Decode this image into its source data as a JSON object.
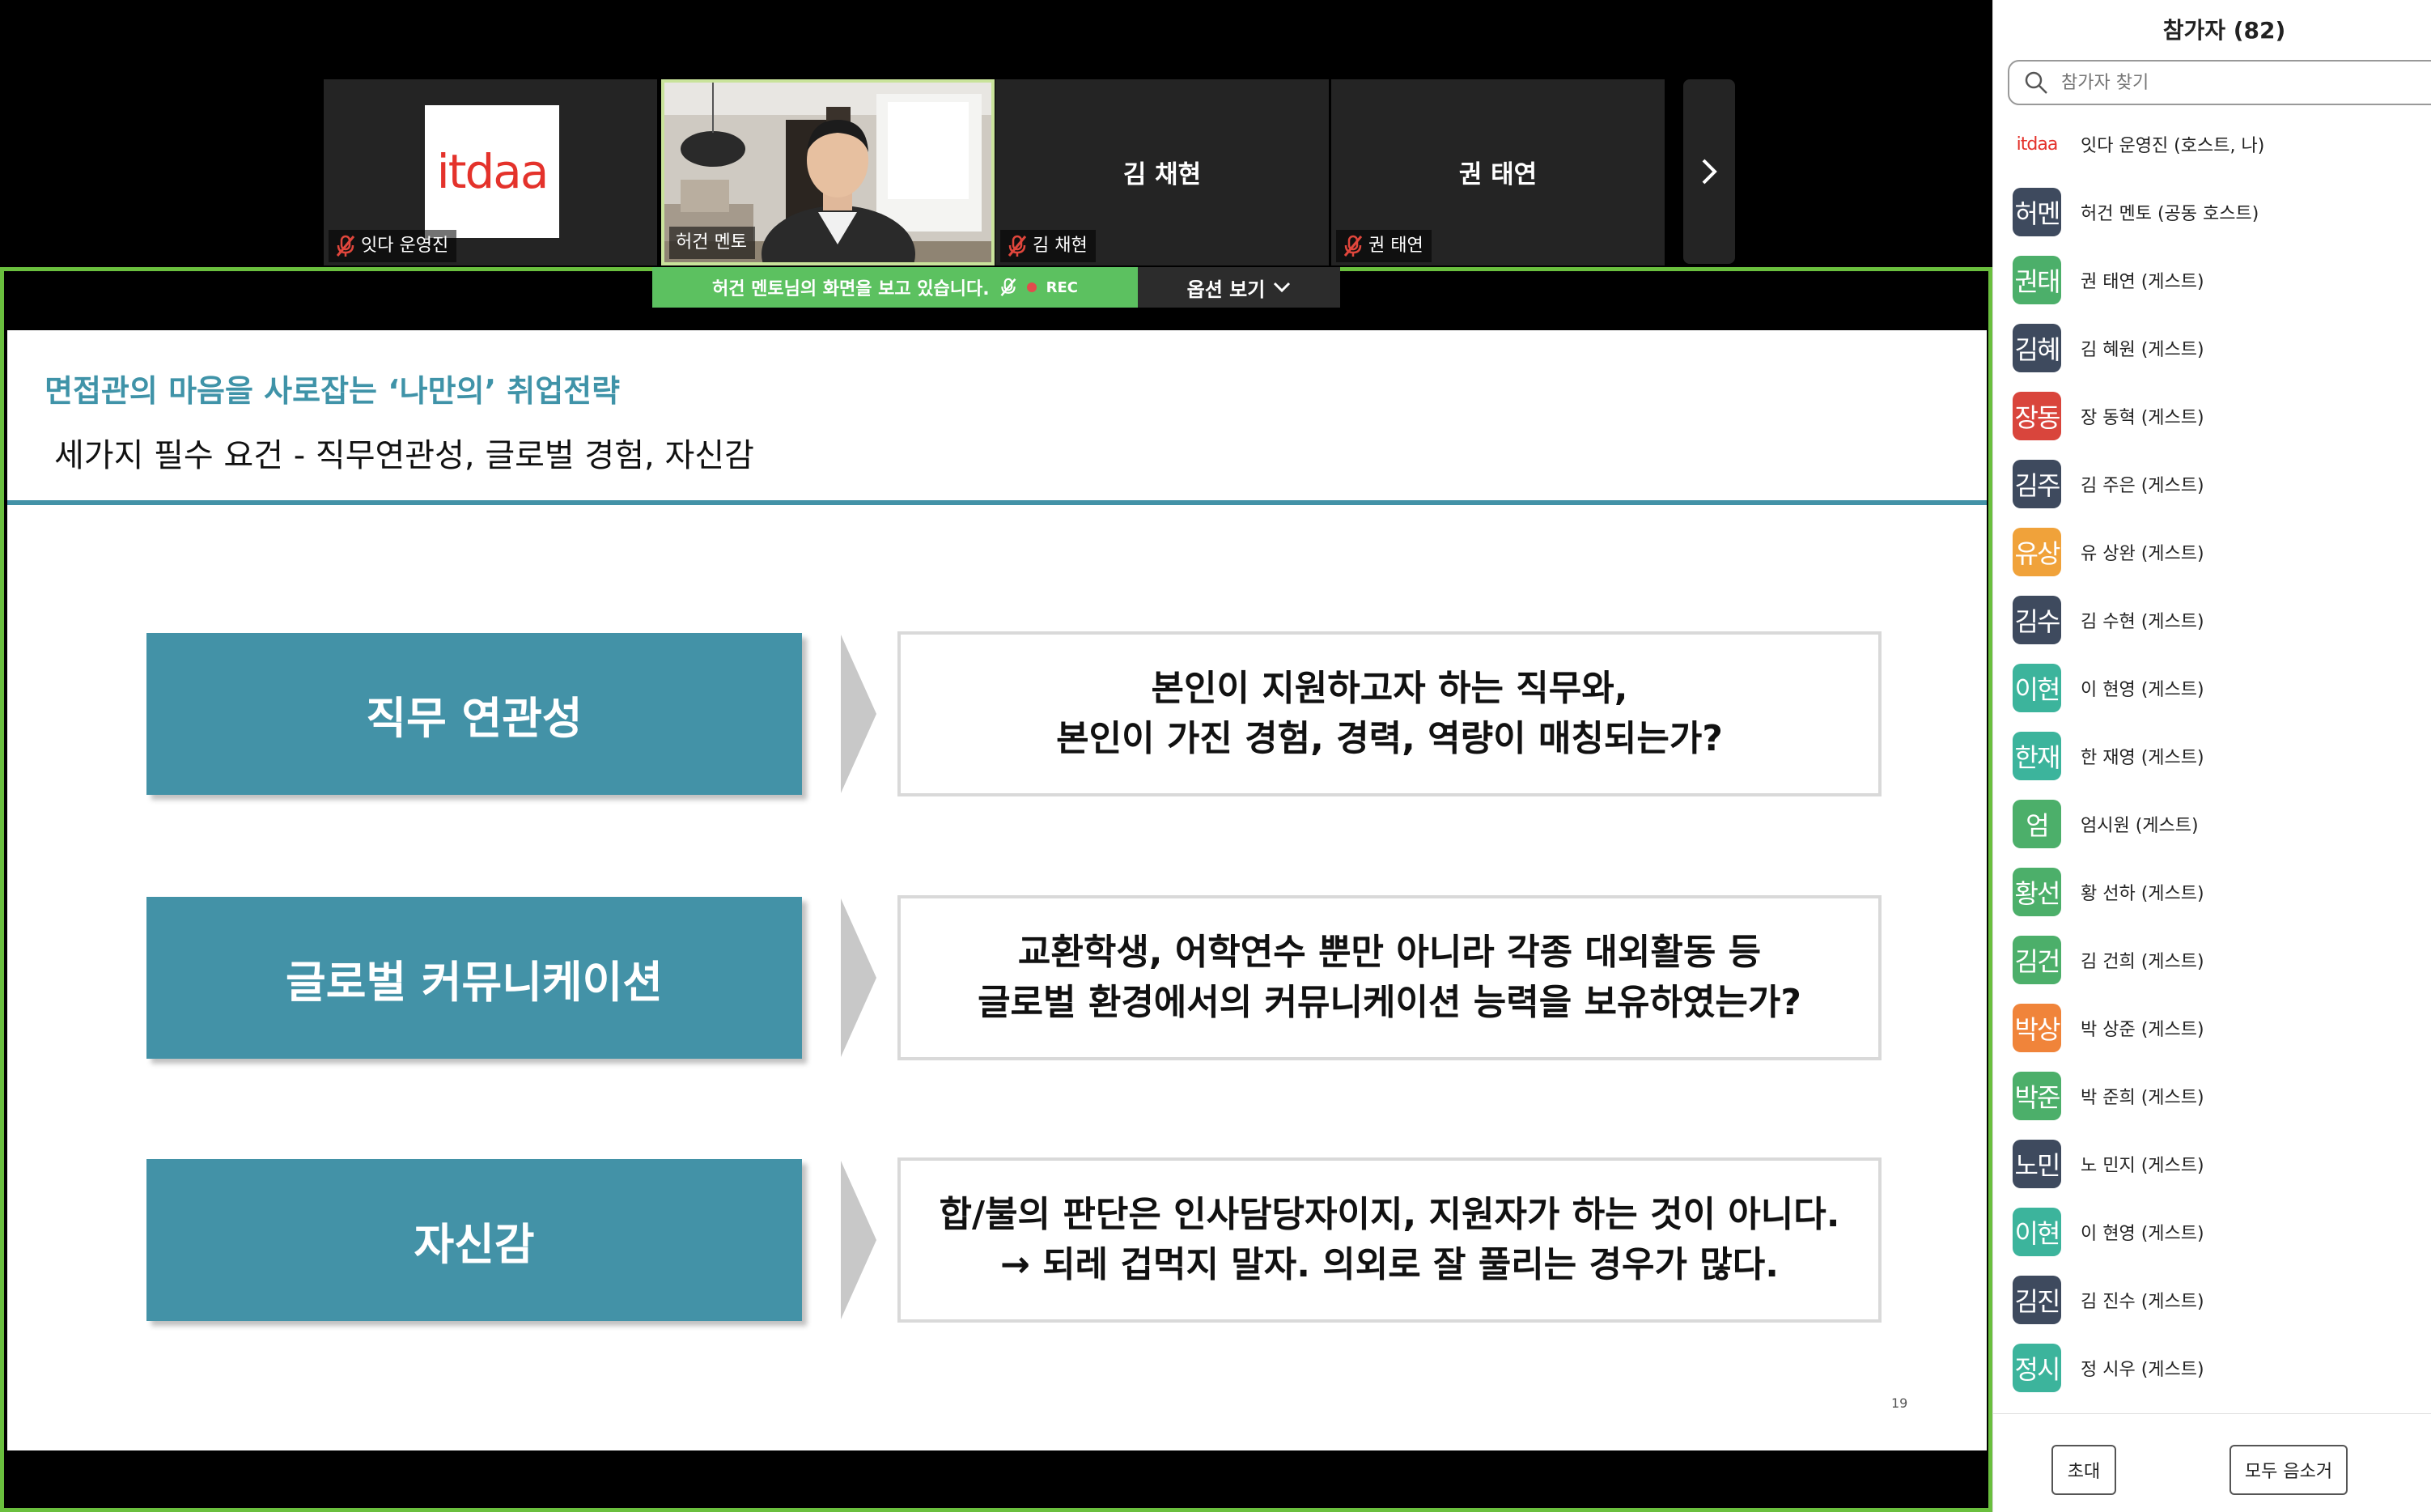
{
  "gallery": {
    "tiles": [
      {
        "name": "잇다 운영진",
        "logo_text": "itdaa",
        "muted": true
      },
      {
        "name": "허건 멘토",
        "muted": false
      },
      {
        "name": "김 채현",
        "center_name": "김 채현",
        "muted": true
      },
      {
        "name": "권 태연",
        "center_name": "권 태연",
        "muted": true
      }
    ]
  },
  "share": {
    "banner_text": "허건 멘토님의 화면을 보고 있습니다.",
    "rec_label": "REC",
    "options_label": "옵션 보기"
  },
  "slide": {
    "header_title": "면접관의 마음을 사로잡는 ‘나만의’ 취업전략",
    "header_subtitle": "세가지 필수 요건 - 직무연관성, 글로벌 경험, 자신감",
    "rows": [
      {
        "label": "직무 연관성",
        "line1": "본인이 지원하고자 하는 직무와,",
        "line2": "본인이 가진 경험, 경력, 역량이 매칭되는가?"
      },
      {
        "label": "글로벌 커뮤니케이션",
        "line1": "교환학생, 어학연수 뿐만 아니라 각종 대외활동 등",
        "line2": "글로벌 환경에서의 커뮤니케이션 능력을 보유하였는가?"
      },
      {
        "label": "자신감",
        "line1": "합/불의 판단은 인사담당자이지, 지원자가 하는 것이 아니다.",
        "line2": "→ 되레 겁먹지 말자. 의외로 잘 풀리는 경우가 많다."
      }
    ],
    "page_number": "19"
  },
  "participants": {
    "title": "참가자 (82)",
    "search_placeholder": "참가자 찾기",
    "list": [
      {
        "initials": "itdaa",
        "name": "잇다 운영진 (호스트, 나)",
        "color": "#ffffff",
        "logo": true
      },
      {
        "initials": "허멘",
        "name": "허건 멘토 (공동 호스트)",
        "color": "#3e4a5e"
      },
      {
        "initials": "권태",
        "name": "권 태연 (게스트)",
        "color": "#4caf6a"
      },
      {
        "initials": "김혜",
        "name": "김 혜원 (게스트)",
        "color": "#3e4a5e"
      },
      {
        "initials": "장동",
        "name": "장 동혁 (게스트)",
        "color": "#d9453c"
      },
      {
        "initials": "김주",
        "name": "김 주은 (게스트)",
        "color": "#3e4a5e"
      },
      {
        "initials": "유상",
        "name": "유 상완 (게스트)",
        "color": "#f0a23a"
      },
      {
        "initials": "김수",
        "name": "김 수현 (게스트)",
        "color": "#3e4a5e"
      },
      {
        "initials": "이현",
        "name": "이 현영 (게스트)",
        "color": "#3cb49c"
      },
      {
        "initials": "한재",
        "name": "한 재영 (게스트)",
        "color": "#3cb49c"
      },
      {
        "initials": "엄",
        "name": "엄시원 (게스트)",
        "color": "#4caf6a"
      },
      {
        "initials": "황선",
        "name": "황 선하 (게스트)",
        "color": "#4caf6a"
      },
      {
        "initials": "김건",
        "name": "김 건희 (게스트)",
        "color": "#4caf6a"
      },
      {
        "initials": "박상",
        "name": "박 상준 (게스트)",
        "color": "#f0843a"
      },
      {
        "initials": "박준",
        "name": "박 준희 (게스트)",
        "color": "#4caf6a"
      },
      {
        "initials": "노민",
        "name": "노 민지 (게스트)",
        "color": "#3e4a5e"
      },
      {
        "initials": "이현",
        "name": "이 현영 (게스트)",
        "color": "#3cb49c"
      },
      {
        "initials": "김진",
        "name": "김 진수 (게스트)",
        "color": "#3e4a5e"
      },
      {
        "initials": "정시",
        "name": "정 시우 (게스트)",
        "color": "#3cb49c"
      }
    ],
    "invite_label": "초대",
    "mute_all_label": "모두 음소거"
  }
}
